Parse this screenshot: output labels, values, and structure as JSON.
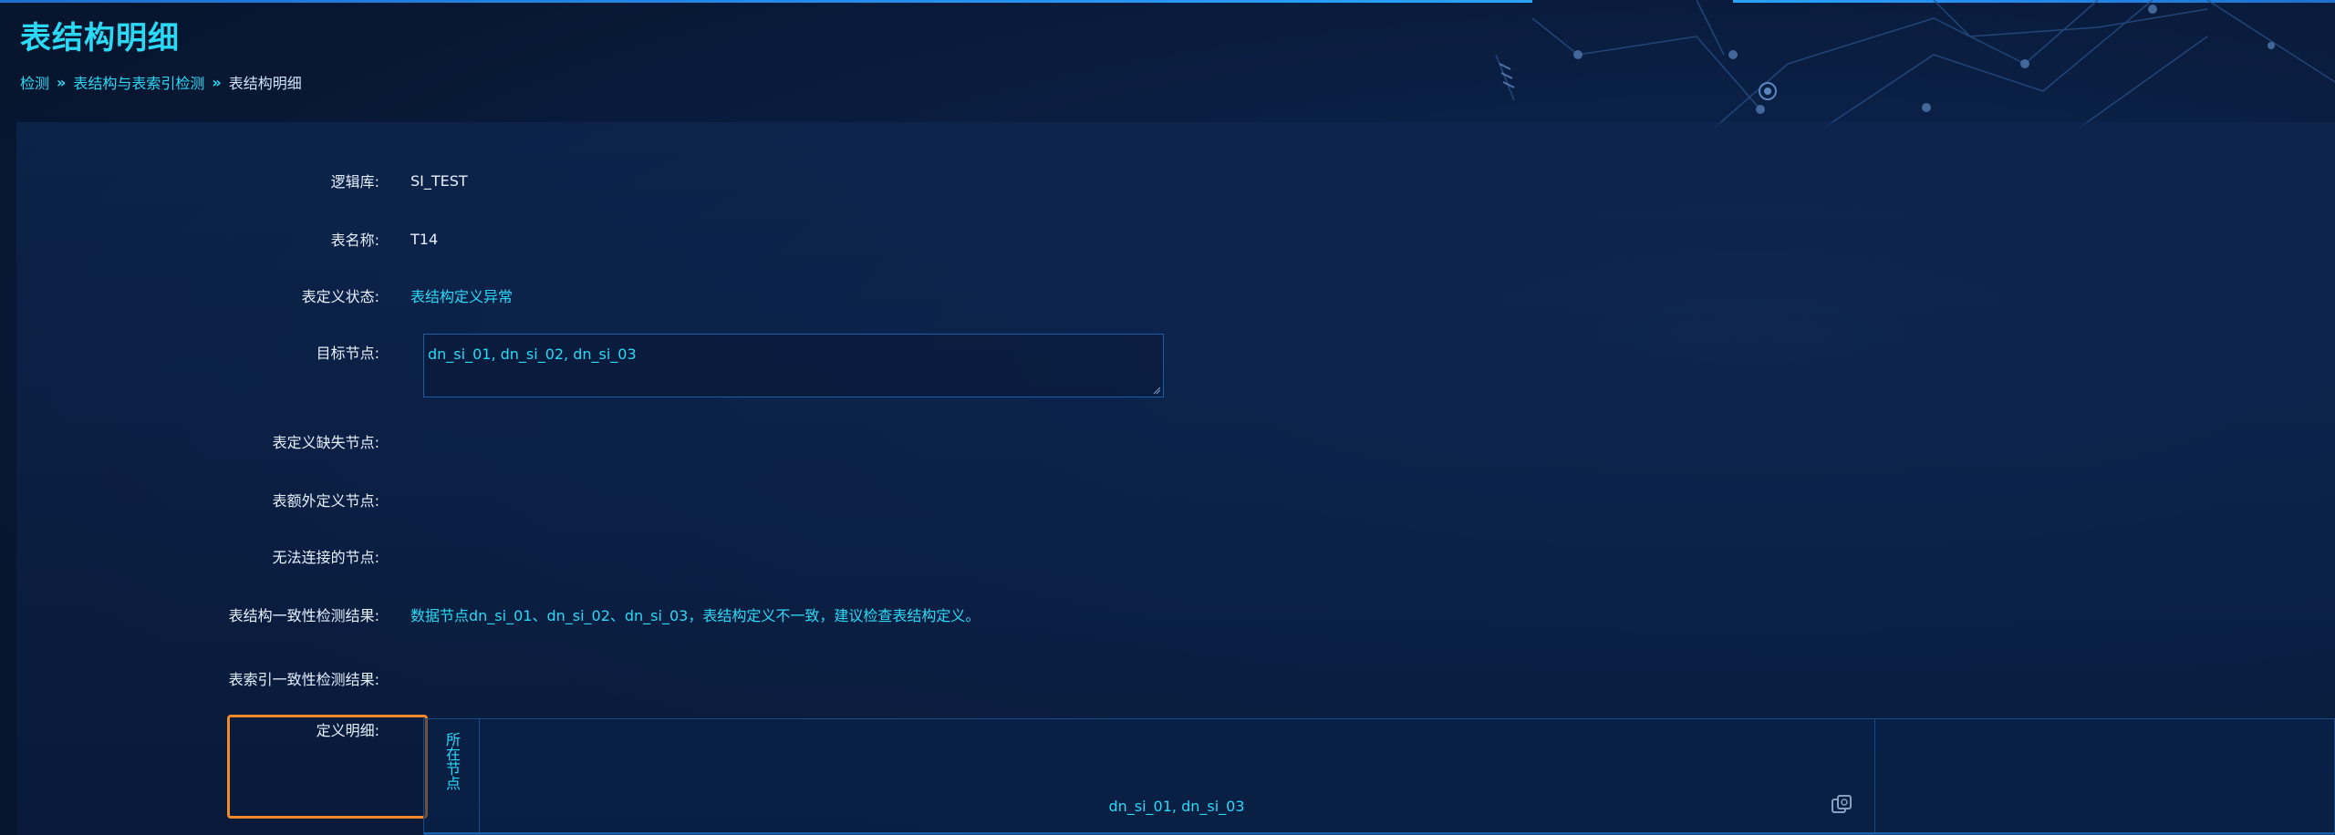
{
  "page": {
    "title": "表结构明细"
  },
  "breadcrumb": {
    "items": [
      "检测",
      "表结构与表索引检测"
    ],
    "current": "表结构明细",
    "separator": "»"
  },
  "fields": [
    {
      "label": "逻辑库:",
      "value": "SI_TEST"
    },
    {
      "label": "表名称:",
      "value": "T14"
    },
    {
      "label": "表定义状态:",
      "value": "表结构定义异常"
    },
    {
      "label": "目标节点:",
      "value": "dn_si_01, dn_si_02, dn_si_03"
    },
    {
      "label": "表定义缺失节点:",
      "value": ""
    },
    {
      "label": "表额外定义节点:",
      "value": ""
    },
    {
      "label": "无法连接的节点:",
      "value": ""
    },
    {
      "label": "表结构一致性检测结果:",
      "value": "数据节点dn_si_01、dn_si_02、dn_si_03，表结构定义不一致，建议检查表结构定义。"
    },
    {
      "label": "表索引一致性检测结果:",
      "value": ""
    },
    {
      "label": "定义明细:",
      "value": ""
    }
  ],
  "detail_table": {
    "node_header": "所在节点",
    "nodes_value": "dn_si_01, dn_si_03",
    "copy_icon": "copy-icon"
  },
  "colors": {
    "accent": "#2bd9f5",
    "highlight": "#f28a2c",
    "background": "#07152e"
  }
}
